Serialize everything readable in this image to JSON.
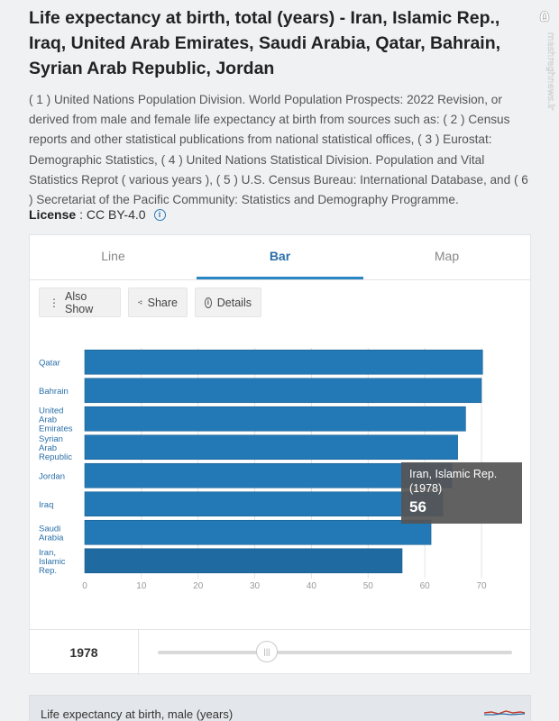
{
  "page": {
    "title": "Life expectancy at birth, total (years) - Iran, Islamic Rep., Iraq, United Arab Emirates, Saudi Arabia, Qatar, Bahrain, Syrian Arab Republic, Jordan",
    "description": "( 1 ) United Nations Population Division. World Population Prospects: 2022 Revision, or derived from male and female life expectancy at birth from sources such as: ( 2 ) Census reports and other statistical publications from national statistical offices, ( 3 ) Eurostat: Demographic Statistics, ( 4 ) United Nations Statistical Division. Population and Vital Statistics Reprot ( various years ), ( 5 ) U.S. Census Bureau: International Database, and ( 6 ) Secretariat of the Pacific Community: Statistics and Demography Programme.",
    "license_label": "License",
    "license_value": ": CC BY-4.0",
    "watermark": "mashreghnews.ir",
    "watermark_mark": "۵"
  },
  "tabs": [
    {
      "label": "Line",
      "active": false
    },
    {
      "label": "Bar",
      "active": true
    },
    {
      "label": "Map",
      "active": false
    }
  ],
  "toolbar": {
    "also_show": "Also Show",
    "share": "Share",
    "details": "Details"
  },
  "tooltip": {
    "country": "Iran, Islamic Rep.",
    "year": "(1978)",
    "value": "56"
  },
  "slider": {
    "year": "1978",
    "thumb_glyph": "|||"
  },
  "next_card": {
    "title": "Life expectancy at birth, male (years)"
  },
  "colors": {
    "bar": "#2379b5",
    "bar_highlight": "#1f6aa0",
    "accent": "#2a86c4"
  },
  "chart_data": {
    "type": "bar",
    "orientation": "horizontal",
    "categories": [
      [
        "Qatar"
      ],
      [
        "Bahrain"
      ],
      [
        "United",
        "Arab",
        "Emirates"
      ],
      [
        "Syrian",
        "Arab",
        "Republic"
      ],
      [
        "Jordan"
      ],
      [
        "Iraq"
      ],
      [
        "Saudi",
        "Arabia"
      ],
      [
        "Iran,",
        "Islamic",
        "Rep."
      ]
    ],
    "values": [
      70.2,
      70.0,
      67.2,
      65.8,
      64.8,
      63.2,
      61.1,
      56.0
    ],
    "xlim": [
      0,
      75
    ],
    "xticks": [
      0,
      10,
      20,
      30,
      40,
      50,
      60,
      70
    ],
    "grid": true,
    "highlight_index": 7
  }
}
